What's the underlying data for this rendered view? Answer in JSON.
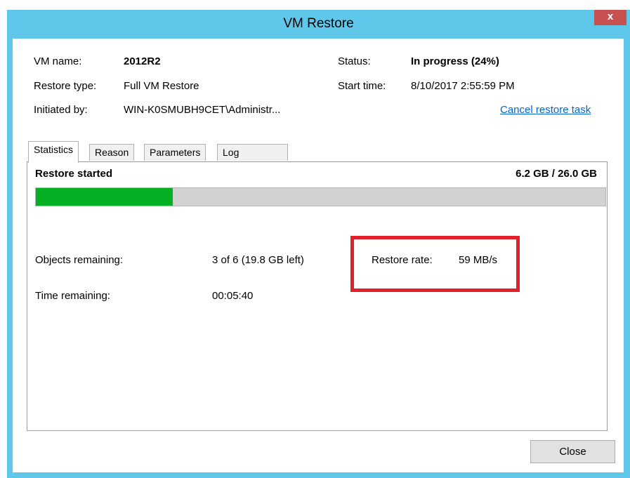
{
  "window": {
    "title": "VM Restore",
    "close_glyph": "x"
  },
  "info": {
    "vm_name_label": "VM name:",
    "vm_name_value": "2012R2",
    "restore_type_label": "Restore type:",
    "restore_type_value": "Full VM Restore",
    "initiated_by_label": "Initiated by:",
    "initiated_by_value": "WIN-K0SMUBH9CET\\Administr...",
    "status_label": "Status:",
    "status_value": "In progress (24%)",
    "start_time_label": "Start time:",
    "start_time_value": "8/10/2017 2:55:59 PM",
    "cancel_link": "Cancel restore task"
  },
  "tabs": [
    {
      "label": "Statistics",
      "active": true
    },
    {
      "label": "Reason",
      "active": false
    },
    {
      "label": "Parameters",
      "active": false
    },
    {
      "label": "Log",
      "active": false
    }
  ],
  "statistics": {
    "header": "Restore started",
    "size_progress": "6.2 GB / 26.0 GB",
    "progress_fraction": 0.24,
    "objects_remaining_label": "Objects remaining:",
    "objects_remaining_value": "3 of 6 (19.8 GB left)",
    "time_remaining_label": "Time remaining:",
    "time_remaining_value": "00:05:40",
    "restore_rate_label": "Restore rate:",
    "restore_rate_value": "59 MB/s"
  },
  "footer": {
    "close_button": "Close"
  },
  "colors": {
    "titlebar": "#5fc8ea",
    "progress_fill": "#06b025",
    "progress_track": "#d2d2d2",
    "highlight_border": "#e0202a",
    "link": "#0066cc"
  }
}
